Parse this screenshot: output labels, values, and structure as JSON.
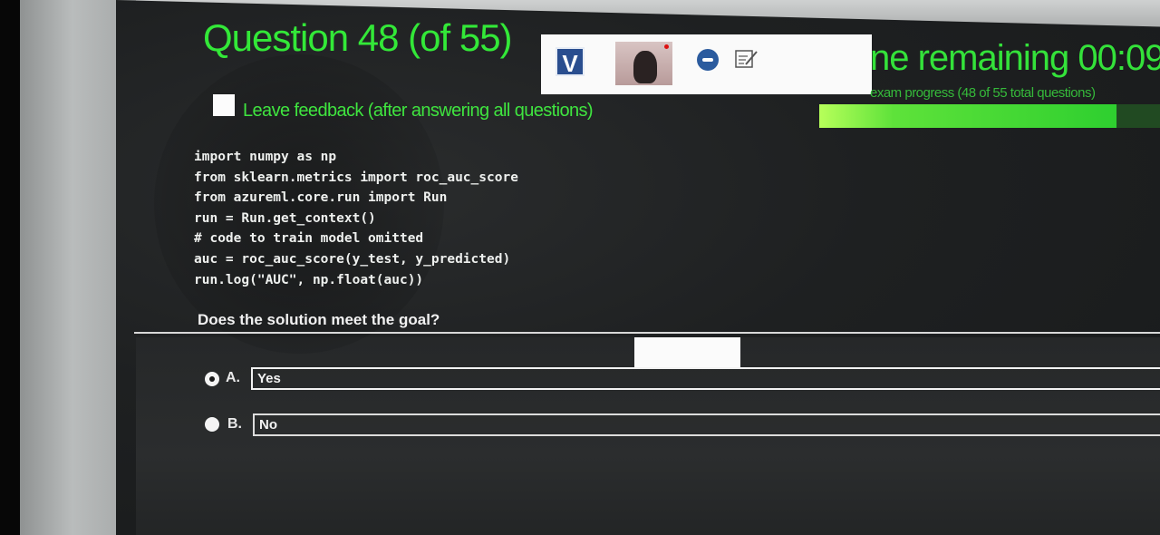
{
  "exam": {
    "question_title": "Question 48 (of 55)",
    "time_remaining_text": "ne remaining 00:09",
    "progress_text": "exam progress (48 of 55 total questions)",
    "progress_fraction": 0.873
  },
  "proctor": {
    "badge_letter": "V"
  },
  "feedback": {
    "label": "Leave feedback (after answering all questions)"
  },
  "code_lines": [
    "import numpy as np",
    "from sklearn.metrics import roc_auc_score",
    "from azureml.core.run import Run",
    "run = Run.get_context()",
    "# code to train model omitted",
    "auc = roc_auc_score(y_test, y_predicted)",
    "run.log(\"AUC\", np.float(auc))"
  ],
  "question": "Does the solution meet the goal?",
  "options": [
    {
      "letter": "A.",
      "text": "Yes"
    },
    {
      "letter": "B.",
      "text": "No"
    }
  ],
  "colors": {
    "accent_green": "#33e838",
    "badge_blue": "#2a4e8f"
  },
  "icons": [
    "chat-icon",
    "notes-icon",
    "webcam-feed"
  ]
}
